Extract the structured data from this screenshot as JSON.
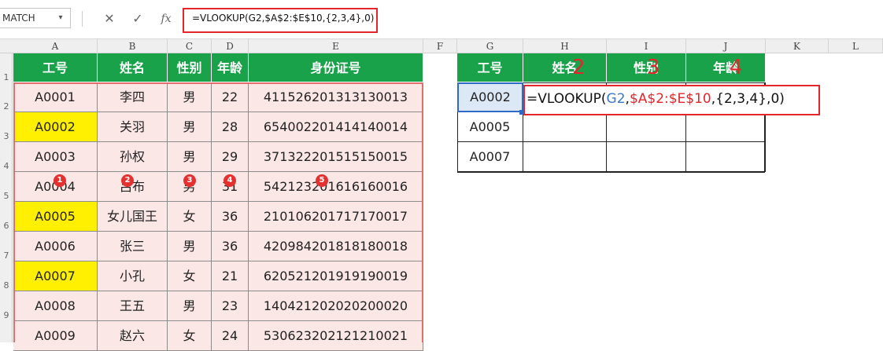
{
  "formula_bar": {
    "name_box": "MATCH",
    "cancel_icon": "✕",
    "enter_icon": "✓",
    "fx_icon": "fx",
    "formula": "=VLOOKUP(G2,$A$2:$E$10,{2,3,4},0)"
  },
  "columns": [
    "A",
    "B",
    "C",
    "D",
    "E",
    "F",
    "G",
    "H",
    "I",
    "J",
    "K",
    "L"
  ],
  "rows": [
    "1",
    "2",
    "3",
    "4",
    "5",
    "6",
    "7",
    "8",
    "9"
  ],
  "table1": {
    "headers": [
      "工号",
      "姓名",
      "性别",
      "年龄",
      "身份证号"
    ],
    "rows": [
      [
        "A0001",
        "李四",
        "男",
        "22",
        "411526201313130013"
      ],
      [
        "A0002",
        "关羽",
        "男",
        "28",
        "654002201414140014"
      ],
      [
        "A0003",
        "孙权",
        "男",
        "29",
        "371322201515150015"
      ],
      [
        "A0004",
        "吕布",
        "男",
        "31",
        "542123201616160016"
      ],
      [
        "A0005",
        "女儿国王",
        "女",
        "36",
        "210106201717170017"
      ],
      [
        "A0006",
        "张三",
        "男",
        "36",
        "420984201818180018"
      ],
      [
        "A0007",
        "小孔",
        "女",
        "21",
        "620521201919190019"
      ],
      [
        "A0008",
        "王五",
        "男",
        "23",
        "140421202020200020"
      ],
      [
        "A0009",
        "赵六",
        "女",
        "24",
        "530623202121210021"
      ]
    ],
    "badges": [
      "1",
      "2",
      "3",
      "4",
      "5"
    ]
  },
  "table2": {
    "headers": [
      "工号",
      "姓名",
      "性别",
      "年龄"
    ],
    "header_numbers": [
      "2",
      "3",
      "4"
    ],
    "ids": [
      "A0002",
      "A0005",
      "A0007"
    ],
    "edit_parts": [
      "=VLOOKUP(",
      "G2",
      ",",
      "$A$2:$E$10",
      ",{2,3,4},0)"
    ]
  },
  "colors": {
    "header_green": "#1aa24a",
    "highlight_yellow": "#ffef00",
    "pink_fill": "#fce7e7",
    "annotation_red": "#e2262b",
    "ref_blue": "#3a78c9"
  }
}
